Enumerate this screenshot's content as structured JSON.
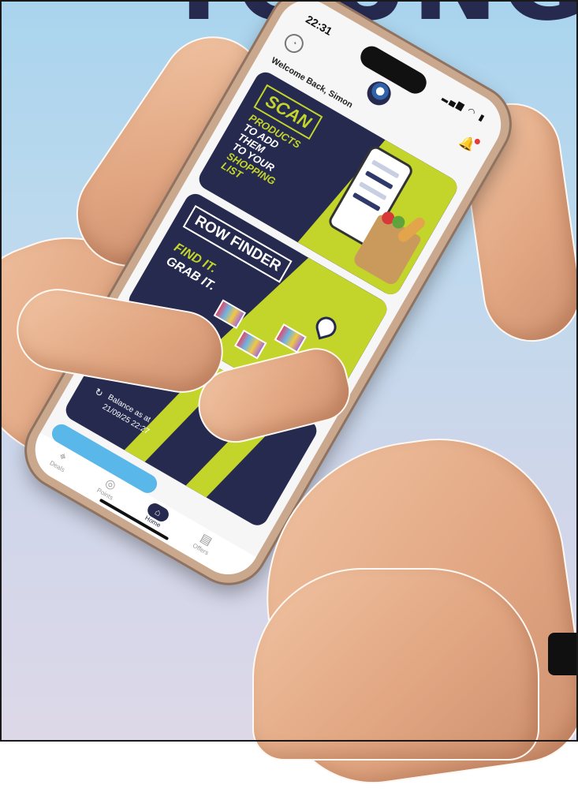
{
  "headline": {
    "text": "YOUNG"
  },
  "colors": {
    "navy": "#262a4f",
    "lime": "#c3d42a",
    "blue": "#59b7ea"
  },
  "phone": {
    "status": {
      "time": "22:31",
      "icons": "signal wifi battery"
    },
    "header": {
      "welcome": "Welcome Back, Simon",
      "profile_icon": "profile-icon",
      "logo": "store-logo",
      "bell_icon": "bell-icon"
    },
    "scan_card": {
      "title": "SCAN",
      "lines": [
        "PRODUCTS",
        "TO ADD",
        "THEM",
        "TO YOUR",
        "SHOPPING",
        "LIST"
      ]
    },
    "row_card": {
      "title": "ROW FINDER",
      "line1": "FIND IT.",
      "line2": "GRAB IT."
    },
    "balance_card": {
      "label": "Balance as at",
      "timestamp": "21/09/25 22:27",
      "refresh_icon": "refresh-icon"
    },
    "tabbar": {
      "tabs": [
        {
          "label": "Deals",
          "icon": "tag-icon"
        },
        {
          "label": "Points",
          "icon": "coin-icon"
        },
        {
          "label": "Home",
          "icon": "home-icon"
        },
        {
          "label": "Offers",
          "icon": "card-icon"
        }
      ],
      "active_index": 2
    }
  },
  "badge": {
    "icon": "apple-icon"
  }
}
